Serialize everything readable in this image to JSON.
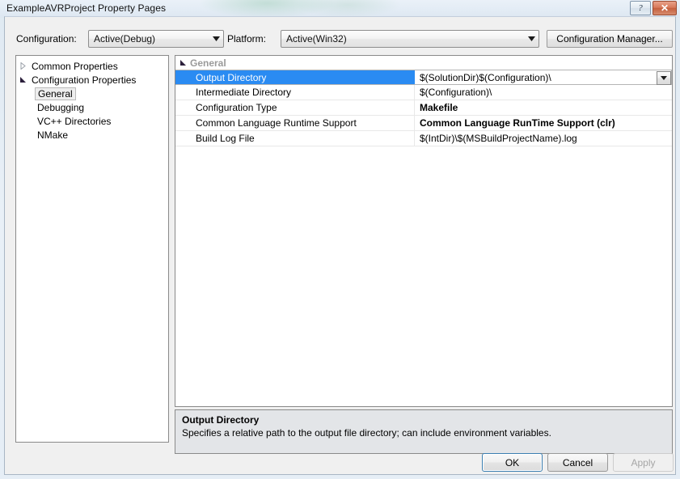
{
  "window": {
    "title": "ExampleAVRProject Property Pages",
    "help_button": "?",
    "close_button": "✕",
    "help_icon": "question-mark-icon",
    "close_icon": "close-x-icon"
  },
  "toolbar": {
    "configuration_label": "Configuration:",
    "configuration_value": "Active(Debug)",
    "platform_label": "Platform:",
    "platform_value": "Active(Win32)",
    "config_manager_label": "Configuration Manager..."
  },
  "tree": {
    "nodes": [
      {
        "label": "Common Properties",
        "expanded": false,
        "selected": false,
        "indent": 0
      },
      {
        "label": "Configuration Properties",
        "expanded": true,
        "selected": false,
        "indent": 0
      }
    ],
    "children": [
      {
        "label": "General",
        "selected": true
      },
      {
        "label": "Debugging",
        "selected": false
      },
      {
        "label": "VC++ Directories",
        "selected": false
      },
      {
        "label": "NMake",
        "selected": false
      }
    ]
  },
  "grid": {
    "category": "General",
    "rows": [
      {
        "name": "Output Directory",
        "value": "$(SolutionDir)$(Configuration)\\",
        "bold": false,
        "selected": true,
        "has_dropdown": true
      },
      {
        "name": "Intermediate Directory",
        "value": "$(Configuration)\\",
        "bold": false,
        "selected": false,
        "has_dropdown": false
      },
      {
        "name": "Configuration Type",
        "value": "Makefile",
        "bold": true,
        "selected": false,
        "has_dropdown": false
      },
      {
        "name": "Common Language Runtime Support",
        "value": "Common Language RunTime Support (clr)",
        "bold": true,
        "selected": false,
        "has_dropdown": false
      },
      {
        "name": "Build Log File",
        "value": "$(IntDir)\\$(MSBuildProjectName).log",
        "bold": false,
        "selected": false,
        "has_dropdown": false
      }
    ]
  },
  "description": {
    "title": "Output Directory",
    "text": "Specifies a relative path to the output file directory; can include environment variables."
  },
  "footer": {
    "ok_label": "OK",
    "cancel_label": "Cancel",
    "apply_label": "Apply",
    "apply_disabled": true
  },
  "colors": {
    "selection_blue": "#2a8bf2",
    "dialog_bg": "#f0f0f0",
    "description_bg": "#e3e5e8",
    "close_red": "#c5603f"
  }
}
